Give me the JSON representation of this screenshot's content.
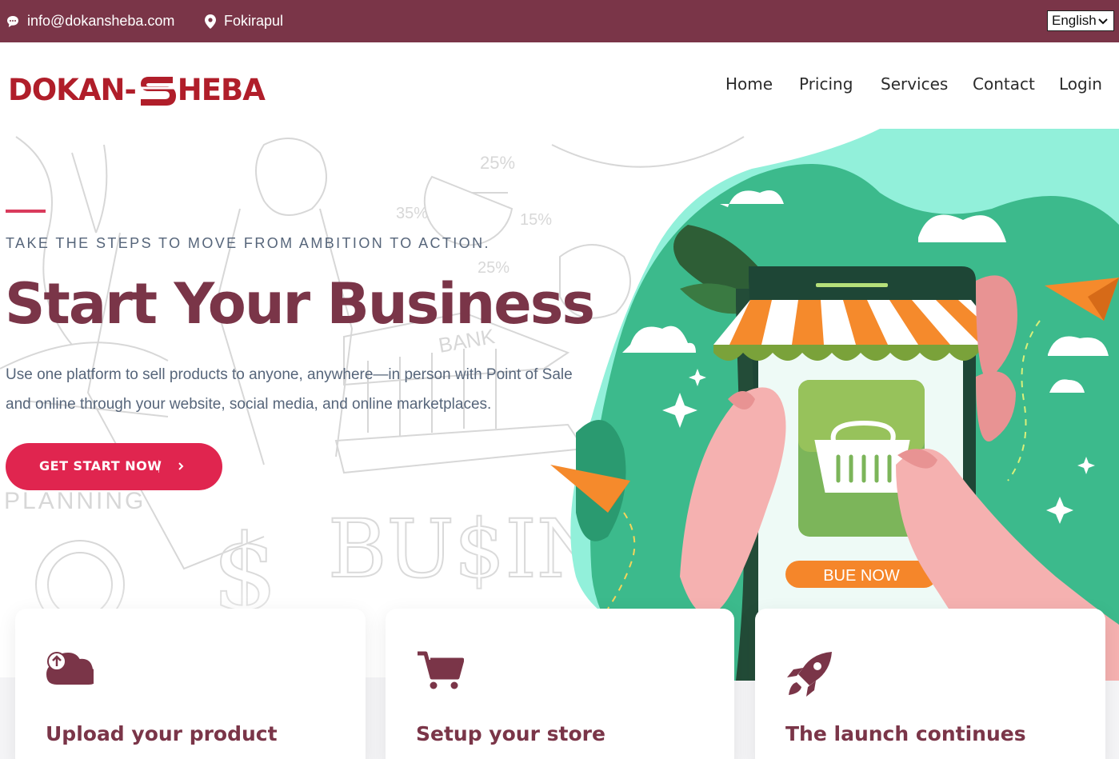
{
  "topbar": {
    "email": "info@dokansheba.com",
    "location": "Fokirapul",
    "language": "English",
    "bg_color": "#7a3548"
  },
  "header": {
    "logo_left": "DOKAN-",
    "logo_right": "HEBA",
    "nav": [
      "Home",
      "Pricing",
      "Services",
      "Contact",
      "Login"
    ]
  },
  "hero": {
    "tagline": "TAKE THE STEPS TO MOVE FROM AMBITION TO ACTION.",
    "title": "Start Your Business",
    "description": "Use one platform to sell products to anyone, anywhere—in person with Point of Sale and online through your website, social media, and online marketplaces.",
    "cta_label": "GET START NOW",
    "sketch_texts": [
      "25%",
      "35%",
      "15%",
      "25%",
      "BANK",
      "PLANNING",
      "BU$INE"
    ],
    "illustration_button": "BUE NOW",
    "accent_color": "#e0254f",
    "title_color": "#7a3548"
  },
  "cards": [
    {
      "title": "Upload your product",
      "icon": "cloud-upload-icon"
    },
    {
      "title": "Setup your store",
      "icon": "shopping-cart-icon"
    },
    {
      "title": "The launch continues",
      "icon": "rocket-icon"
    }
  ]
}
